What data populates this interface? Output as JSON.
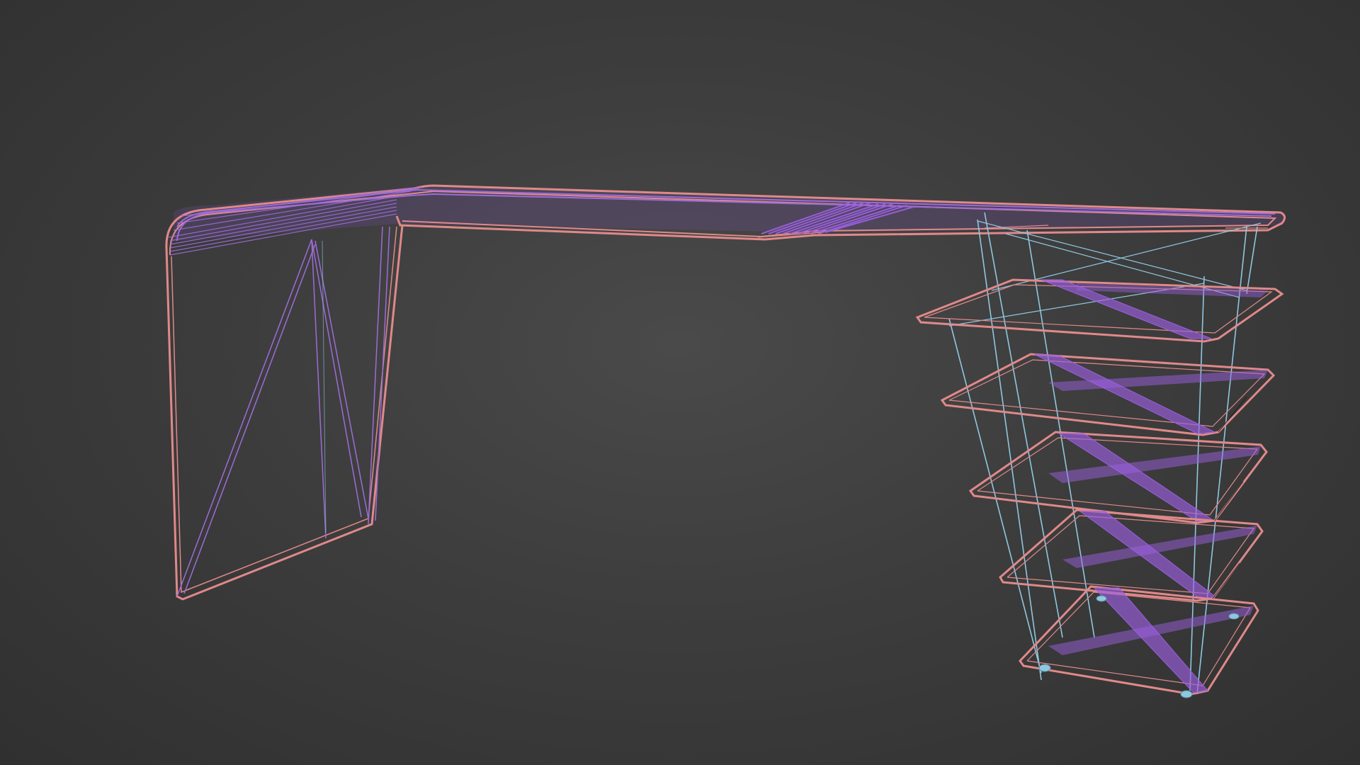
{
  "viewport": {
    "shading": "wireframe",
    "background_color": "#3c3c3c"
  },
  "model": {
    "object": "desk-with-shelving-unit",
    "colors": {
      "edge_outer": "#e0898a",
      "edge_inner": "#9d6cd8",
      "fill_dense": "#9b5fe0",
      "drawer_frame": "#8fc7df",
      "dark_edge": "#1c1c1c"
    },
    "shelf_count": 5
  }
}
